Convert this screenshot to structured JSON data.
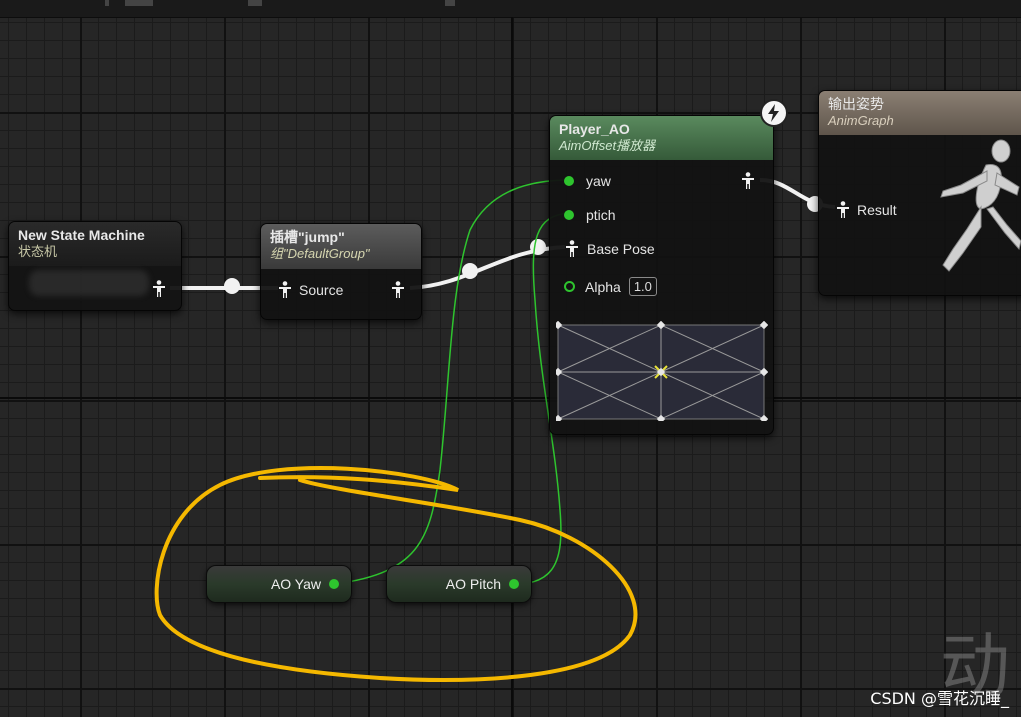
{
  "nodes": {
    "state_machine": {
      "title": "New State Machine",
      "subtitle": "状态机"
    },
    "slot": {
      "title": "插槽\"jump\"",
      "subtitle": "组\"DefaultGroup\"",
      "pin_source": "Source"
    },
    "aim_offset": {
      "title": "Player_AO",
      "subtitle": "AimOffset播放器",
      "pins": {
        "yaw": "yaw",
        "ptich": "ptich",
        "base_pose": "Base Pose",
        "alpha": "Alpha"
      },
      "alpha_value": "1.0"
    },
    "output_pose": {
      "title": "输出姿势",
      "subtitle": "AnimGraph",
      "pin_result": "Result"
    },
    "ao_yaw": {
      "label": "AO Yaw"
    },
    "ao_pitch": {
      "label": "AO Pitch"
    }
  },
  "overlay": {
    "big_char": "动",
    "watermark": "CSDN @雪花沉睡_"
  },
  "colors": {
    "float_pin": "#2ec42e",
    "annotation_circle": "#f5b800",
    "aim_offset_header": "#3f6a43",
    "output_header": "#6e6358"
  },
  "icons": [
    "pose-pin-icon",
    "lightning-icon",
    "running-mannequin-icon"
  ]
}
